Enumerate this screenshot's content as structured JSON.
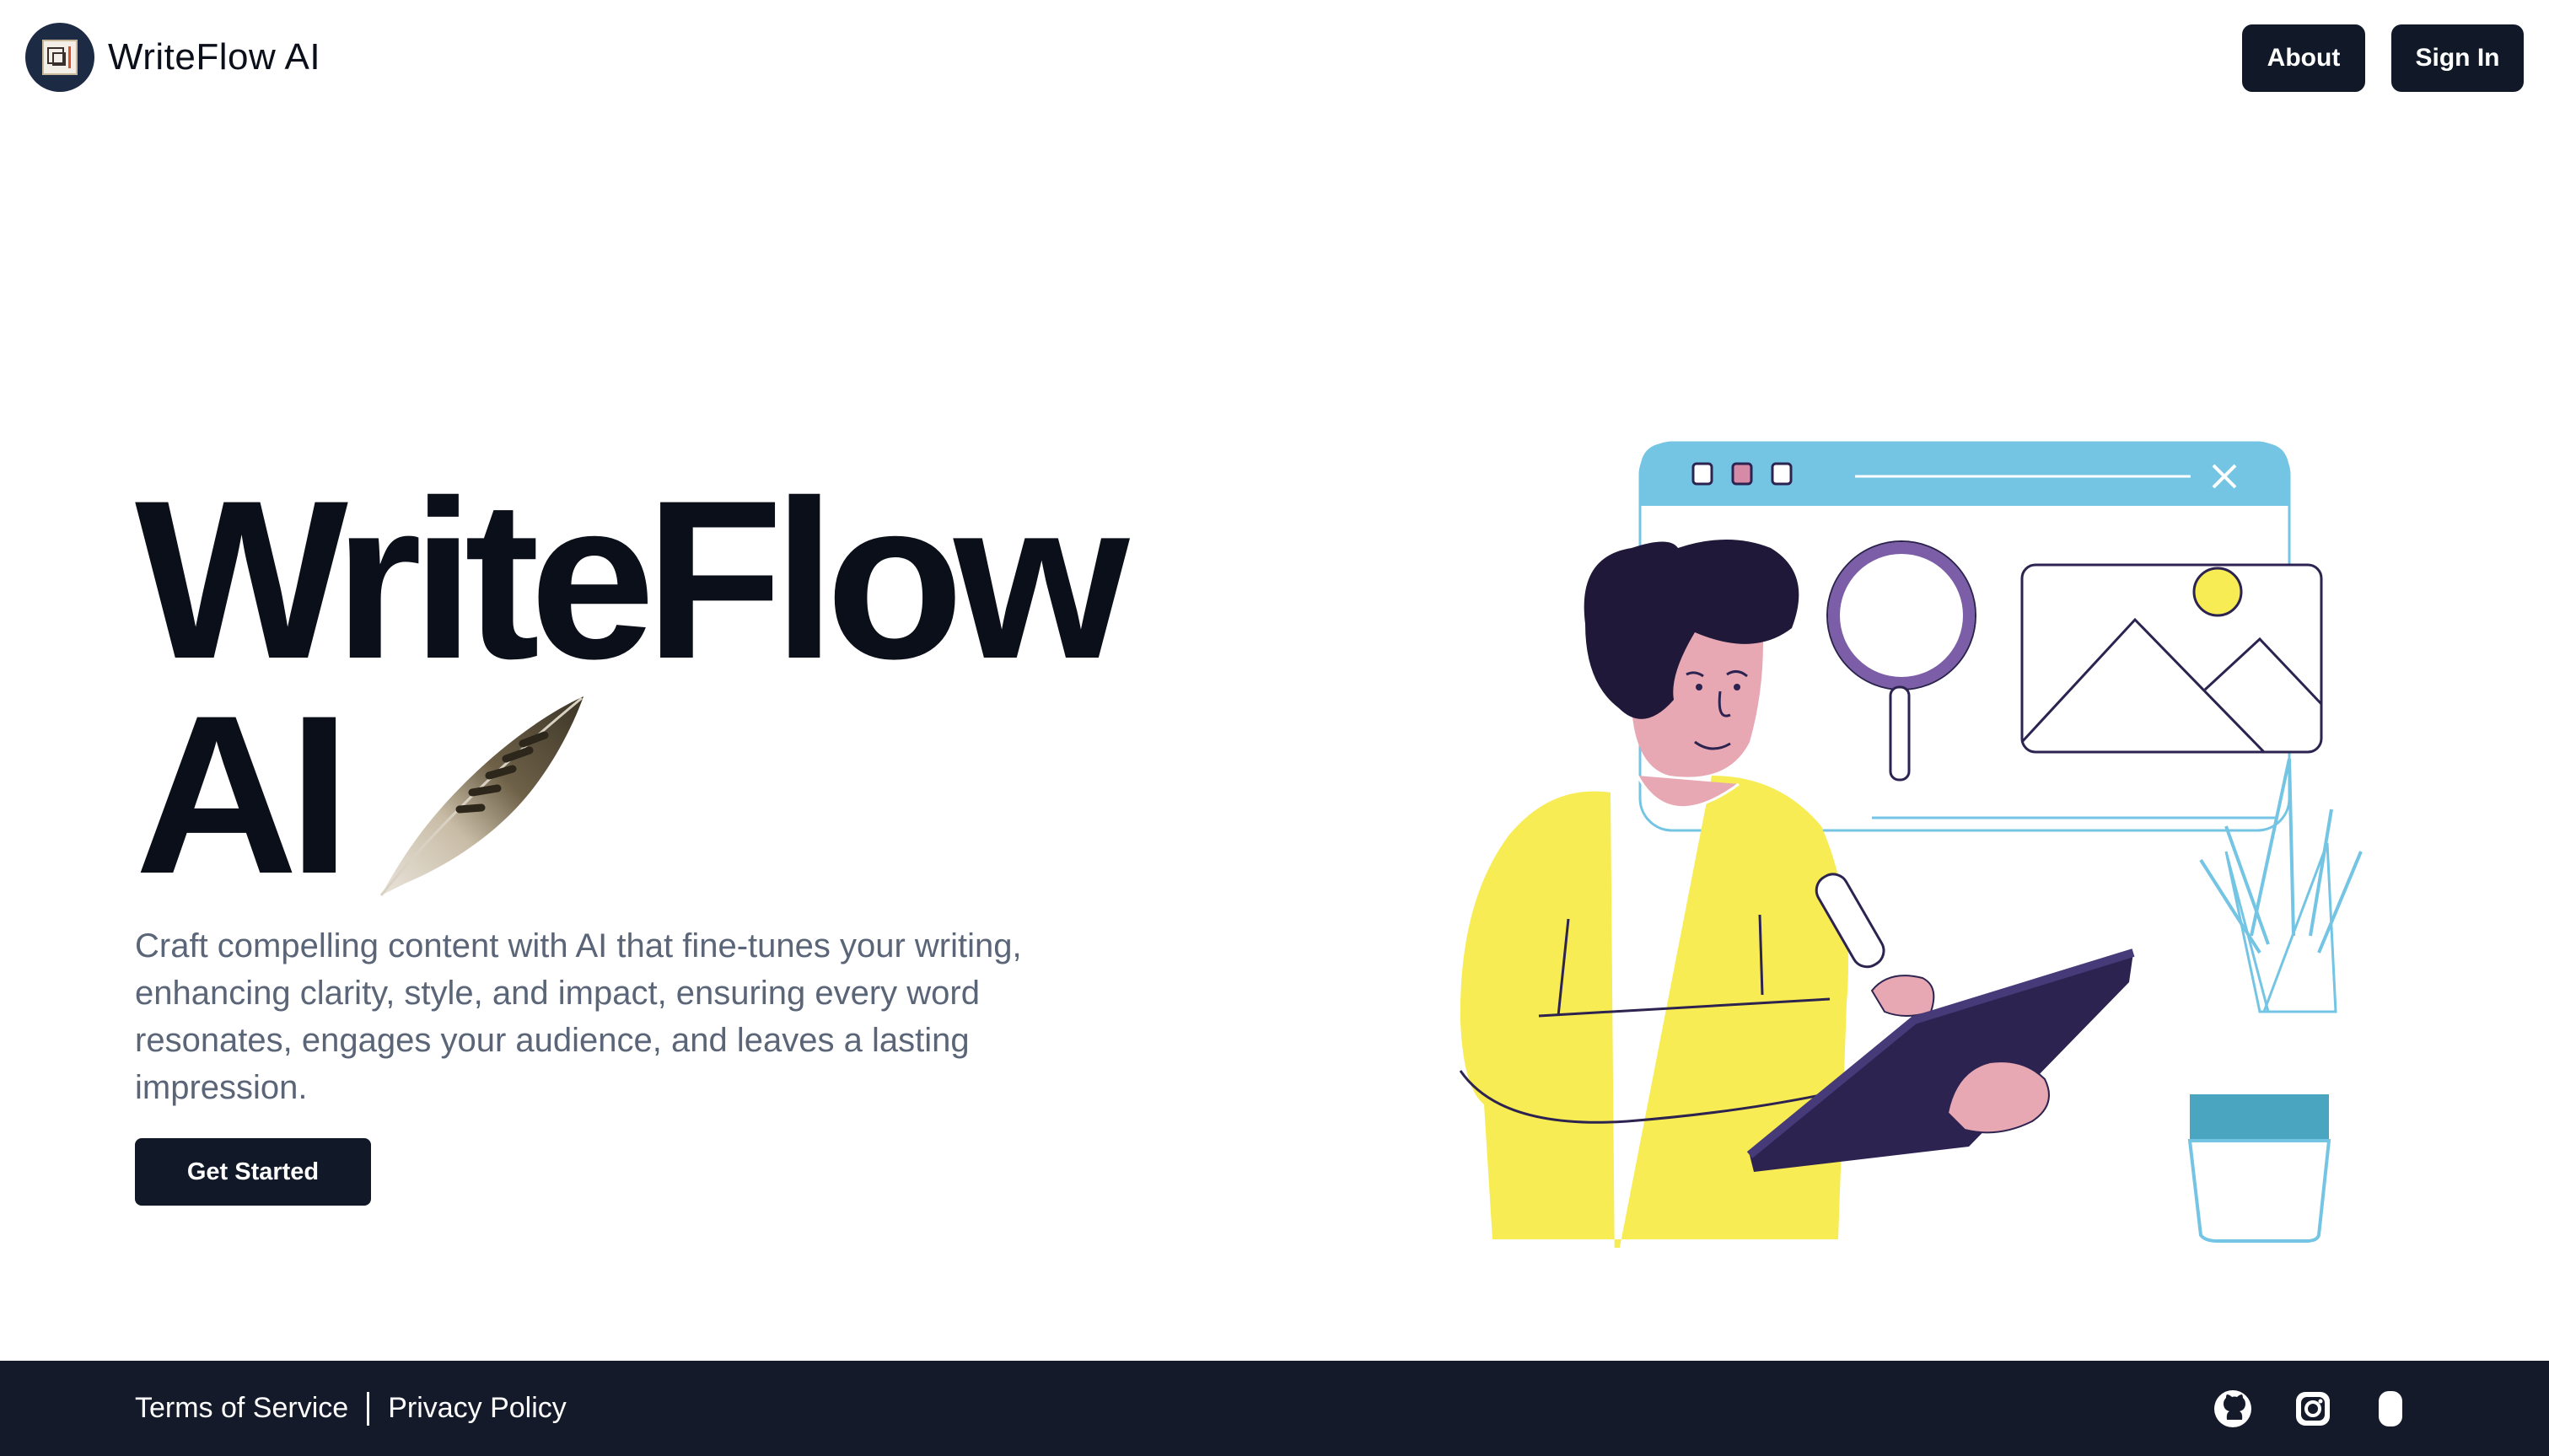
{
  "header": {
    "brand_name": "WriteFlow AI",
    "logo_icon": "document-logo-icon",
    "nav": {
      "about_label": "About",
      "signin_label": "Sign In"
    }
  },
  "hero": {
    "title_line1": "WriteFlow",
    "title_line2": "AI",
    "feather_icon": "feather-icon",
    "description": "Craft compelling content with AI that fine-tunes your writing, enhancing clarity, style, and impact, ensuring every word resonates, engages your audience, and leaves a lasting impression.",
    "cta_label": "Get Started",
    "illustration": "person-writing-on-tablet-illustration"
  },
  "footer": {
    "terms_label": "Terms of Service",
    "privacy_label": "Privacy Policy",
    "social": [
      "github-icon",
      "instagram-icon",
      "app-icon"
    ]
  },
  "colors": {
    "primary_dark": "#111827",
    "footer_bg": "#141a2a",
    "desc_text": "#5b6578",
    "illustration_yellow": "#f7ec54",
    "illustration_blue": "#74c4e4",
    "illustration_purple": "#2d2350"
  }
}
